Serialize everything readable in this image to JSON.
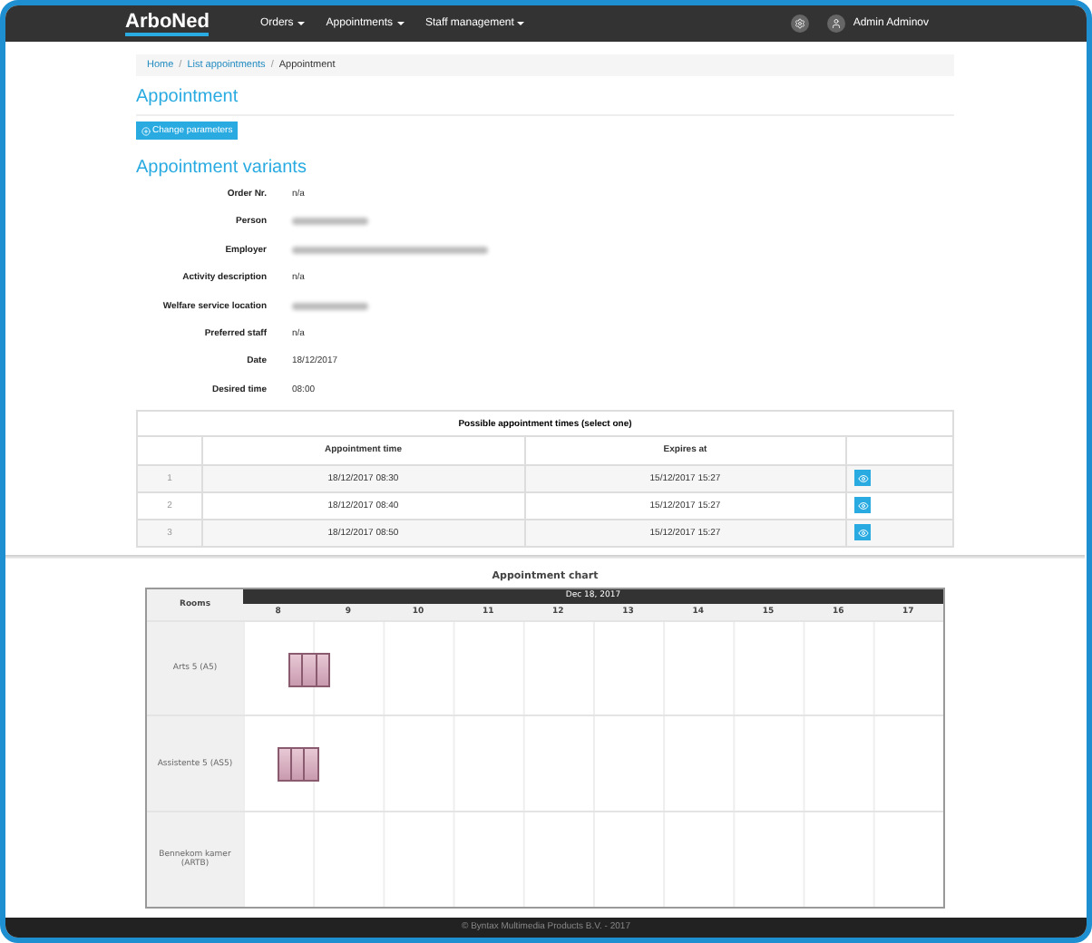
{
  "navbar": {
    "logo": "ArboNed",
    "menus": [
      {
        "label": "Orders",
        "caret": true
      },
      {
        "label": "Appointments",
        "caret": true
      },
      {
        "label": "Staff management",
        "caret": true
      }
    ],
    "user": "Admin Adminov"
  },
  "breadcrumb_separator": "/",
  "breadcrumb": [
    {
      "label": "Home",
      "kind": "link"
    },
    {
      "label": "List appointments",
      "kind": "link"
    },
    {
      "label": "Appointment",
      "kind": "current"
    }
  ],
  "title": "Appointment",
  "change_button": "Change parameters",
  "variants_title": "Appointment variants",
  "details": [
    {
      "label": "Order Nr.",
      "kind": "text",
      "value": "n/a"
    },
    {
      "label": "Person",
      "kind": "redacted"
    },
    {
      "label": "Employer",
      "kind": "redacted-long"
    },
    {
      "label": "Activity description",
      "kind": "text",
      "value": "n/a"
    },
    {
      "label": "Welfare service location",
      "kind": "redacted"
    },
    {
      "label": "Preferred staff",
      "kind": "text",
      "value": "n/a"
    },
    {
      "label": "Date",
      "kind": "text",
      "value": "18/12/2017"
    },
    {
      "label": "Desired time",
      "kind": "text",
      "value": "08:00"
    }
  ],
  "times_table": {
    "title": "Possible appointment times (select one)",
    "columns": [
      "Appointment time",
      "Expires at"
    ],
    "rows": [
      {
        "index": "1",
        "time": "18/12/2017 08:30",
        "expires": "15/12/2017 15:27"
      },
      {
        "index": "2",
        "time": "18/12/2017 08:40",
        "expires": "15/12/2017 15:27"
      },
      {
        "index": "3",
        "time": "18/12/2017 08:50",
        "expires": "15/12/2017 15:27"
      }
    ]
  },
  "chart": {
    "title": "Appointment chart",
    "rooms_header": "Rooms",
    "date": "Dec 18, 2017",
    "hours": [
      "8",
      "9",
      "10",
      "11",
      "12",
      "13",
      "14",
      "15",
      "16",
      "17"
    ],
    "rooms": [
      {
        "name": "Arts 5 (A5)",
        "booked": true
      },
      {
        "name": "Assistente 5 (AS5)",
        "booked": true
      },
      {
        "name": "Bennekom kamer (ARTB)",
        "booked": false
      }
    ]
  },
  "footer": "© Byntax Multimedia Products B.V. - 2017"
}
